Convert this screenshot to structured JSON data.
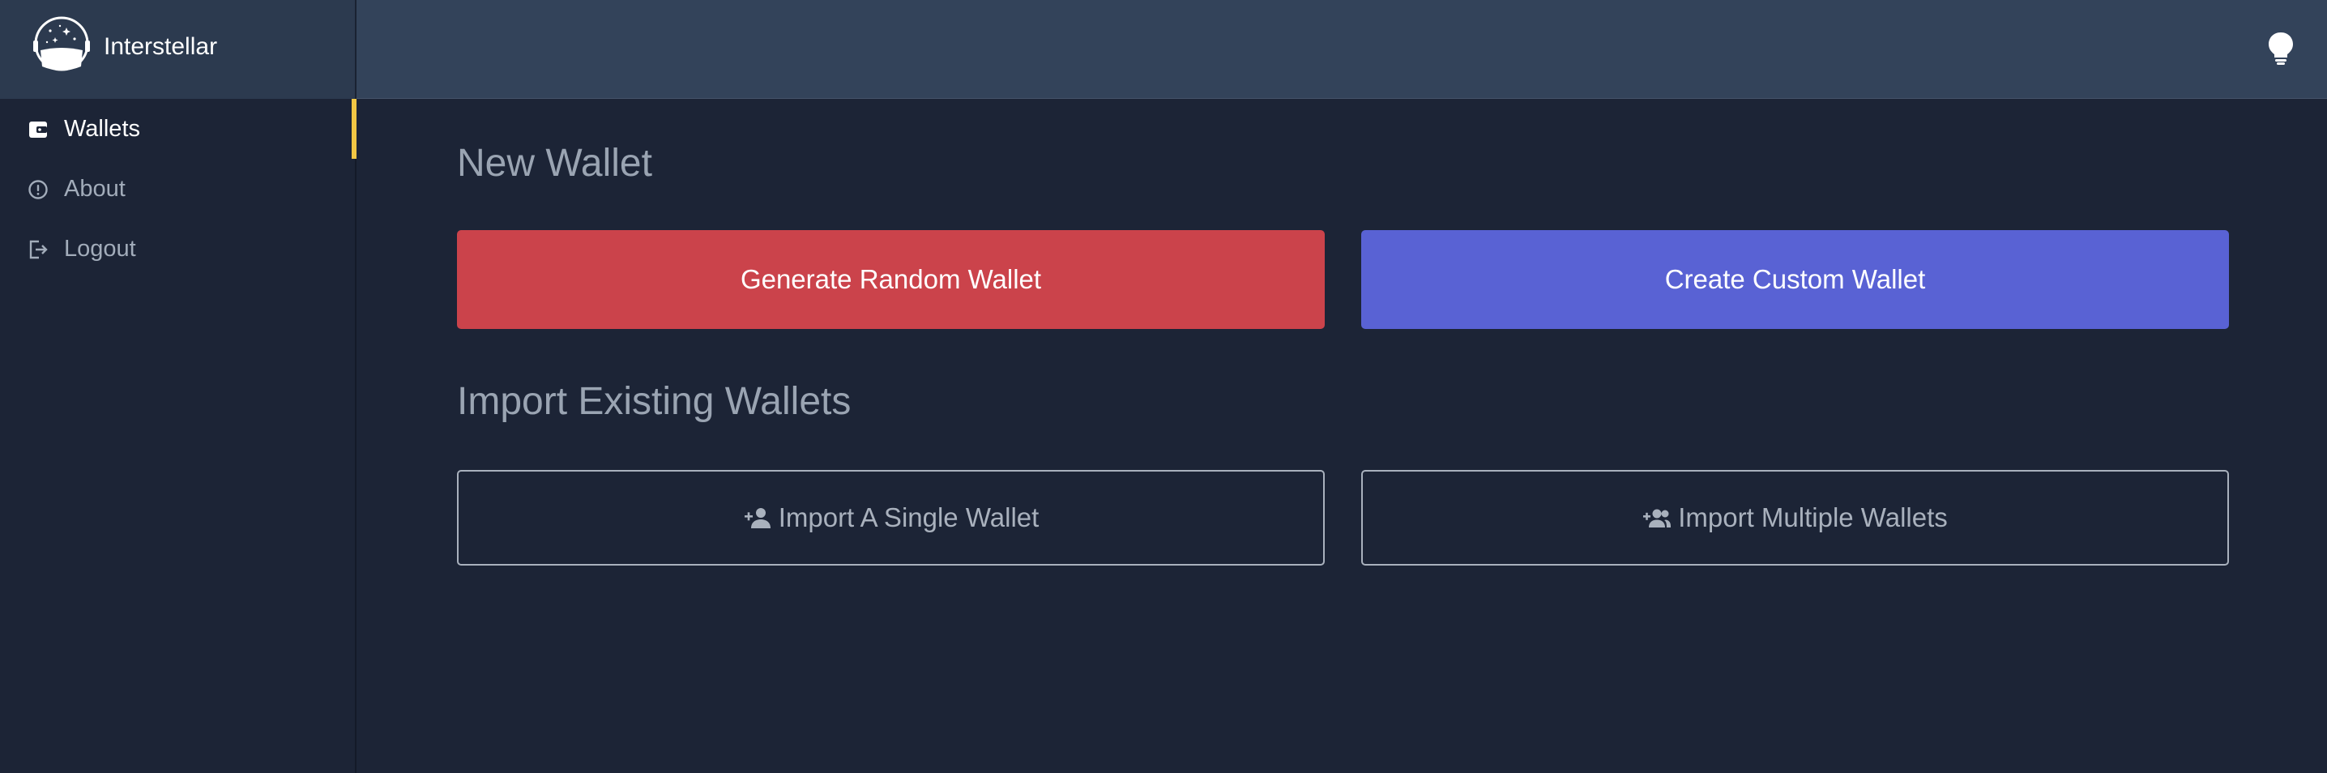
{
  "app": {
    "name": "Interstellar",
    "logo_icon": "astronaut-helmet-icon",
    "theme_icon": "lightbulb-icon"
  },
  "sidebar": {
    "items": [
      {
        "label": "Wallets",
        "icon": "wallet-icon",
        "active": true
      },
      {
        "label": "About",
        "icon": "info-circle-icon",
        "active": false
      },
      {
        "label": "Logout",
        "icon": "logout-icon",
        "active": false
      }
    ],
    "active_indicator_color": "#f2c744"
  },
  "main": {
    "new_wallet": {
      "heading": "New Wallet",
      "generate_label": "Generate Random Wallet",
      "create_label": "Create Custom Wallet"
    },
    "import": {
      "heading": "Import Existing Wallets",
      "single_label": "Import A Single Wallet",
      "single_icon": "person-add-icon",
      "multiple_label": "Import Multiple Wallets",
      "multiple_icon": "group-add-icon"
    }
  },
  "colors": {
    "topbar": "#33435a",
    "background": "#1c2436",
    "generate_button": "#cb434b",
    "create_button": "#5962d4",
    "outline_button": "#a9b1bd"
  }
}
